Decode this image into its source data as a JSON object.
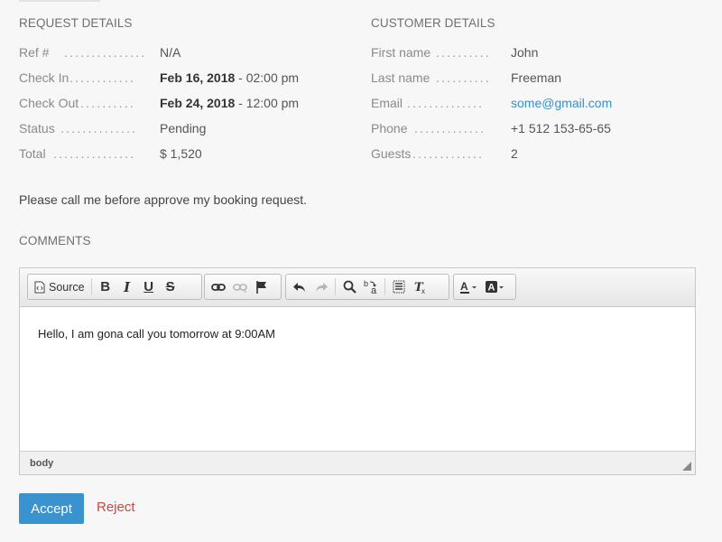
{
  "request": {
    "title": "REQUEST DETAILS",
    "rows": [
      {
        "label": "Ref #",
        "value_bold": "",
        "value": "N/A"
      },
      {
        "label": "Check In",
        "value_bold": "Feb 16, 2018",
        "value": " - 02:00 pm"
      },
      {
        "label": "Check Out",
        "value_bold": "Feb 24, 2018",
        "value": " - 12:00 pm"
      },
      {
        "label": "Status",
        "value_bold": "",
        "value": "Pending"
      },
      {
        "label": "Total",
        "value_bold": "",
        "value": "$ 1,520"
      }
    ]
  },
  "customer": {
    "title": "CUSTOMER DETAILS",
    "first_name_label": "First name",
    "first_name": "John",
    "last_name_label": "Last name",
    "last_name": "Freeman",
    "email_label": "Email",
    "email": "some@gmail.com",
    "phone_label": "Phone",
    "phone": "+1 512 153-65-65",
    "guests_label": "Guests",
    "guests": "2"
  },
  "note": "Please call me before approve my booking request.",
  "comments": {
    "title": "COMMENTS",
    "toolbar": {
      "source_label": "Source",
      "icons": [
        "source-icon",
        "bold-icon",
        "italic-icon",
        "underline-icon",
        "strike-icon",
        "link-icon",
        "unlink-icon",
        "anchor-flag-icon",
        "undo-icon",
        "redo-icon",
        "find-icon",
        "replace-icon",
        "select-all-icon",
        "remove-format-icon",
        "text-color-icon",
        "background-color-icon"
      ]
    },
    "editor_text": "Hello, I am gona call you tomorrow at 9:00AM",
    "path_label": "body"
  },
  "actions": {
    "accept_label": "Accept",
    "reject_label": "Reject"
  },
  "colors": {
    "accent": "#3a92cf",
    "link": "#3a8fc9",
    "reject": "#c9473f",
    "background": "#f7f7f7"
  }
}
